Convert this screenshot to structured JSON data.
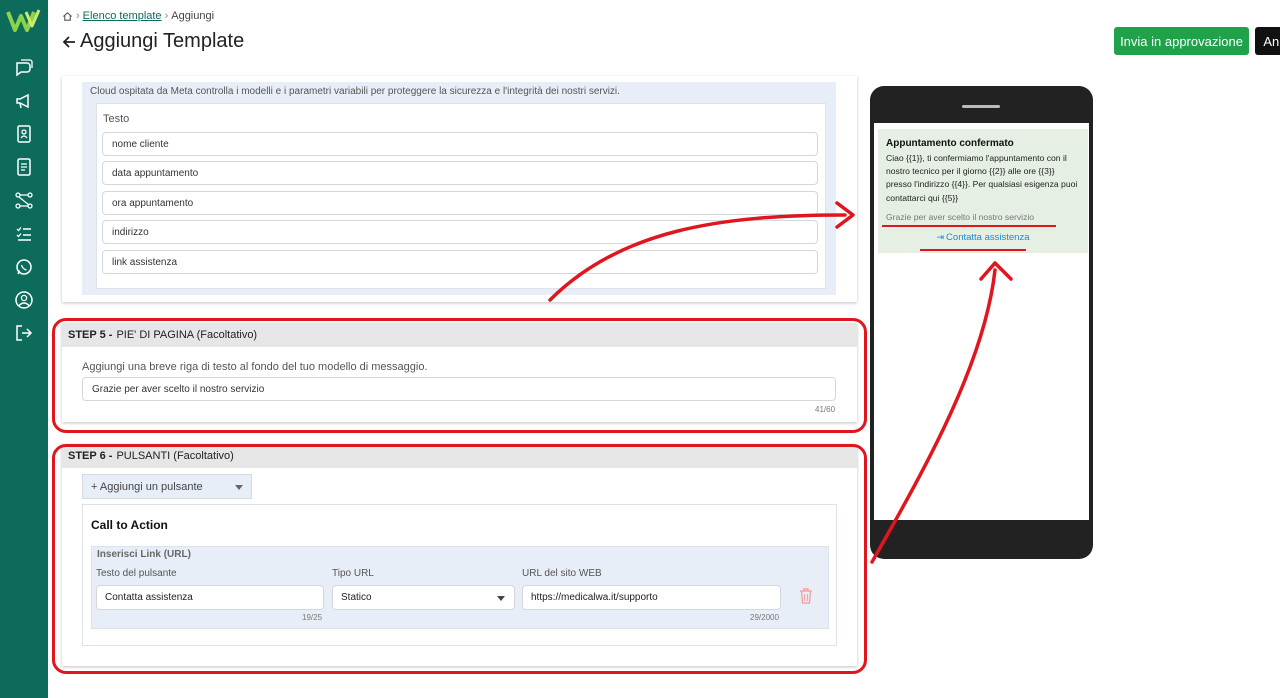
{
  "breadcrumb": {
    "parent": "Elenco template",
    "current": "Aggiungi"
  },
  "page": {
    "title": "Aggiungi Template"
  },
  "actions": {
    "approve_label": "Invia in approvazione",
    "cancel_label": "Annulla"
  },
  "body_section": {
    "note": "Cloud ospitata da Meta controlla i modelli e i parametri variabili per proteggere la sicurezza e l'integrità dei nostri servizi.",
    "testo_label": "Testo",
    "variables": [
      "nome cliente",
      "data appuntamento",
      "ora appuntamento",
      "indirizzo",
      "link assistenza"
    ]
  },
  "step5": {
    "step": "STEP 5 -",
    "title": "PIE' DI PAGINA (Facoltativo)",
    "description": "Aggiungi una breve riga di testo al fondo del tuo modello di messaggio.",
    "footer_value": "Grazie per aver scelto il nostro servizio",
    "counter": "41/60"
  },
  "step6": {
    "step": "STEP 6 -",
    "title": "PULSANTI (Facoltativo)",
    "add_button_label": "+ Aggiungi un pulsante",
    "cta_title": "Call to Action",
    "link_panel_title": "Inserisci Link (URL)",
    "fields": {
      "button_text_label": "Testo del pulsante",
      "button_text_value": "Contatta assistenza",
      "button_text_counter": "19/25",
      "url_type_label": "Tipo URL",
      "url_type_value": "Statico",
      "url_label": "URL del sito WEB",
      "url_value": "https://medicalwa.it/supporto",
      "url_counter": "29/2000"
    }
  },
  "preview": {
    "title": "Appuntamento confermato",
    "body": "Ciao {{1}}, ti confermiamo l'appuntamento con il nostro tecnico per il giorno {{2}} alle ore {{3}} presso l'indirizzo {{4}}. Per qualsiasi esigenza puoi contattarci qui {{5}}",
    "footer": "Grazie per aver scelto il nostro servizio",
    "button": "Contatta assistenza"
  },
  "colors": {
    "sidebar": "#0d6b5c",
    "approve": "#1fa24a",
    "cancel": "#111111",
    "highlight": "#e0161e",
    "link": "#1d8ad6"
  },
  "icons": [
    "logo-icon",
    "chat-icon",
    "megaphone-icon",
    "contacts-icon",
    "document-icon",
    "flow-icon",
    "checklist-icon",
    "whatsapp-icon",
    "user-icon",
    "logout-icon",
    "home-icon",
    "arrow-left-icon",
    "trash-icon",
    "external-link-icon"
  ]
}
